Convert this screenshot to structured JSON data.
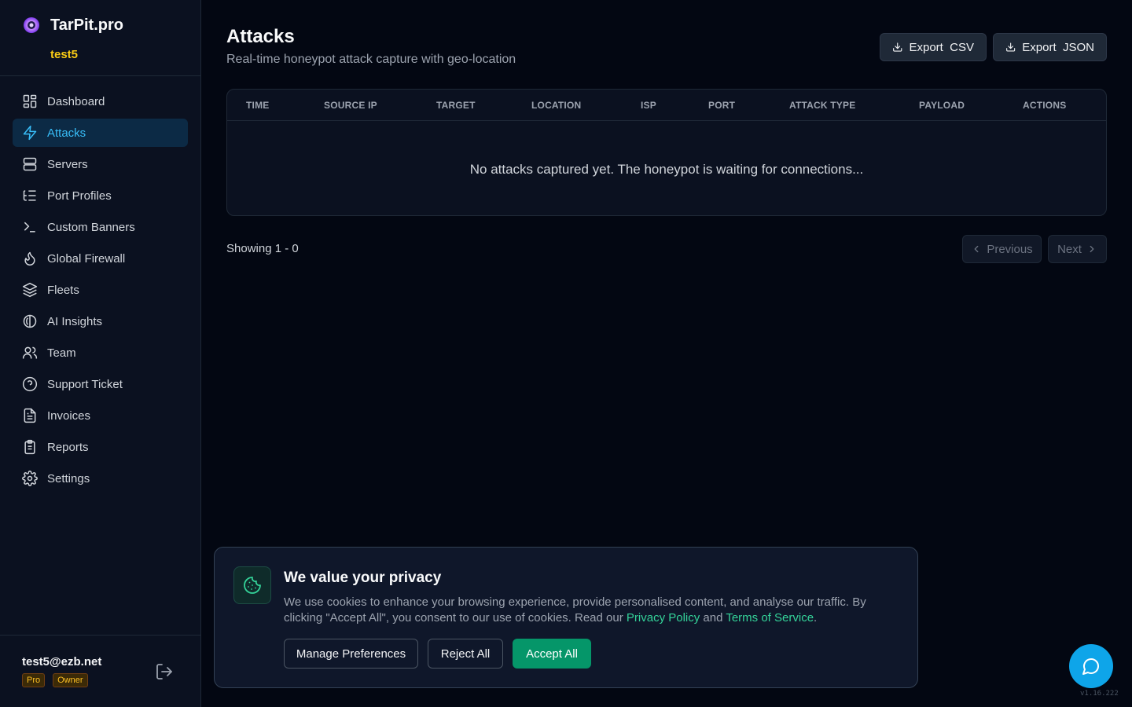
{
  "app": {
    "name": "TarPit.pro",
    "org": "test5"
  },
  "sidebar": {
    "items": [
      {
        "label": "Dashboard",
        "icon": "grid-icon",
        "active": false
      },
      {
        "label": "Attacks",
        "icon": "lightning-icon",
        "active": true
      },
      {
        "label": "Servers",
        "icon": "server-icon",
        "active": false
      },
      {
        "label": "Port Profiles",
        "icon": "list-tree-icon",
        "active": false
      },
      {
        "label": "Custom Banners",
        "icon": "terminal-icon",
        "active": false
      },
      {
        "label": "Global Firewall",
        "icon": "flame-icon",
        "active": false
      },
      {
        "label": "Fleets",
        "icon": "layers-icon",
        "active": false
      },
      {
        "label": "AI Insights",
        "icon": "brain-icon",
        "active": false
      },
      {
        "label": "Team",
        "icon": "users-icon",
        "active": false
      },
      {
        "label": "Support Ticket",
        "icon": "help-circle-icon",
        "active": false
      },
      {
        "label": "Invoices",
        "icon": "file-text-icon",
        "active": false
      },
      {
        "label": "Reports",
        "icon": "clipboard-icon",
        "active": false
      },
      {
        "label": "Settings",
        "icon": "gear-icon",
        "active": false
      }
    ]
  },
  "user": {
    "email": "test5@ezb.net",
    "plan": "Pro",
    "role": "Owner"
  },
  "header": {
    "title": "Attacks",
    "subtitle": "Real-time honeypot attack capture with geo-location",
    "export_csv": "Export  CSV",
    "export_json": "Export  JSON"
  },
  "table": {
    "columns": [
      "TIME",
      "SOURCE IP",
      "TARGET",
      "LOCATION",
      "ISP",
      "PORT",
      "ATTACK TYPE",
      "PAYLOAD",
      "ACTIONS"
    ],
    "empty_message": "No attacks captured yet. The honeypot is waiting for connections..."
  },
  "pagination": {
    "showing": "Showing 1 - 0",
    "previous": "Previous",
    "next": "Next"
  },
  "cookie": {
    "title": "We value your privacy",
    "text_before": "We use cookies to enhance your browsing experience, provide personalised content, and analyse our traffic. By clicking \"Accept All\", you consent to our use of cookies. Read our ",
    "privacy_link": "Privacy Policy",
    "and": " and ",
    "terms_link": "Terms of Service",
    "period": ".",
    "manage": "Manage Preferences",
    "reject": "Reject All",
    "accept": "Accept All"
  },
  "version": "v1.16.222",
  "colors": {
    "accent": "#38bdf8",
    "brand_green": "#059669",
    "badge": "#fbbf24"
  }
}
